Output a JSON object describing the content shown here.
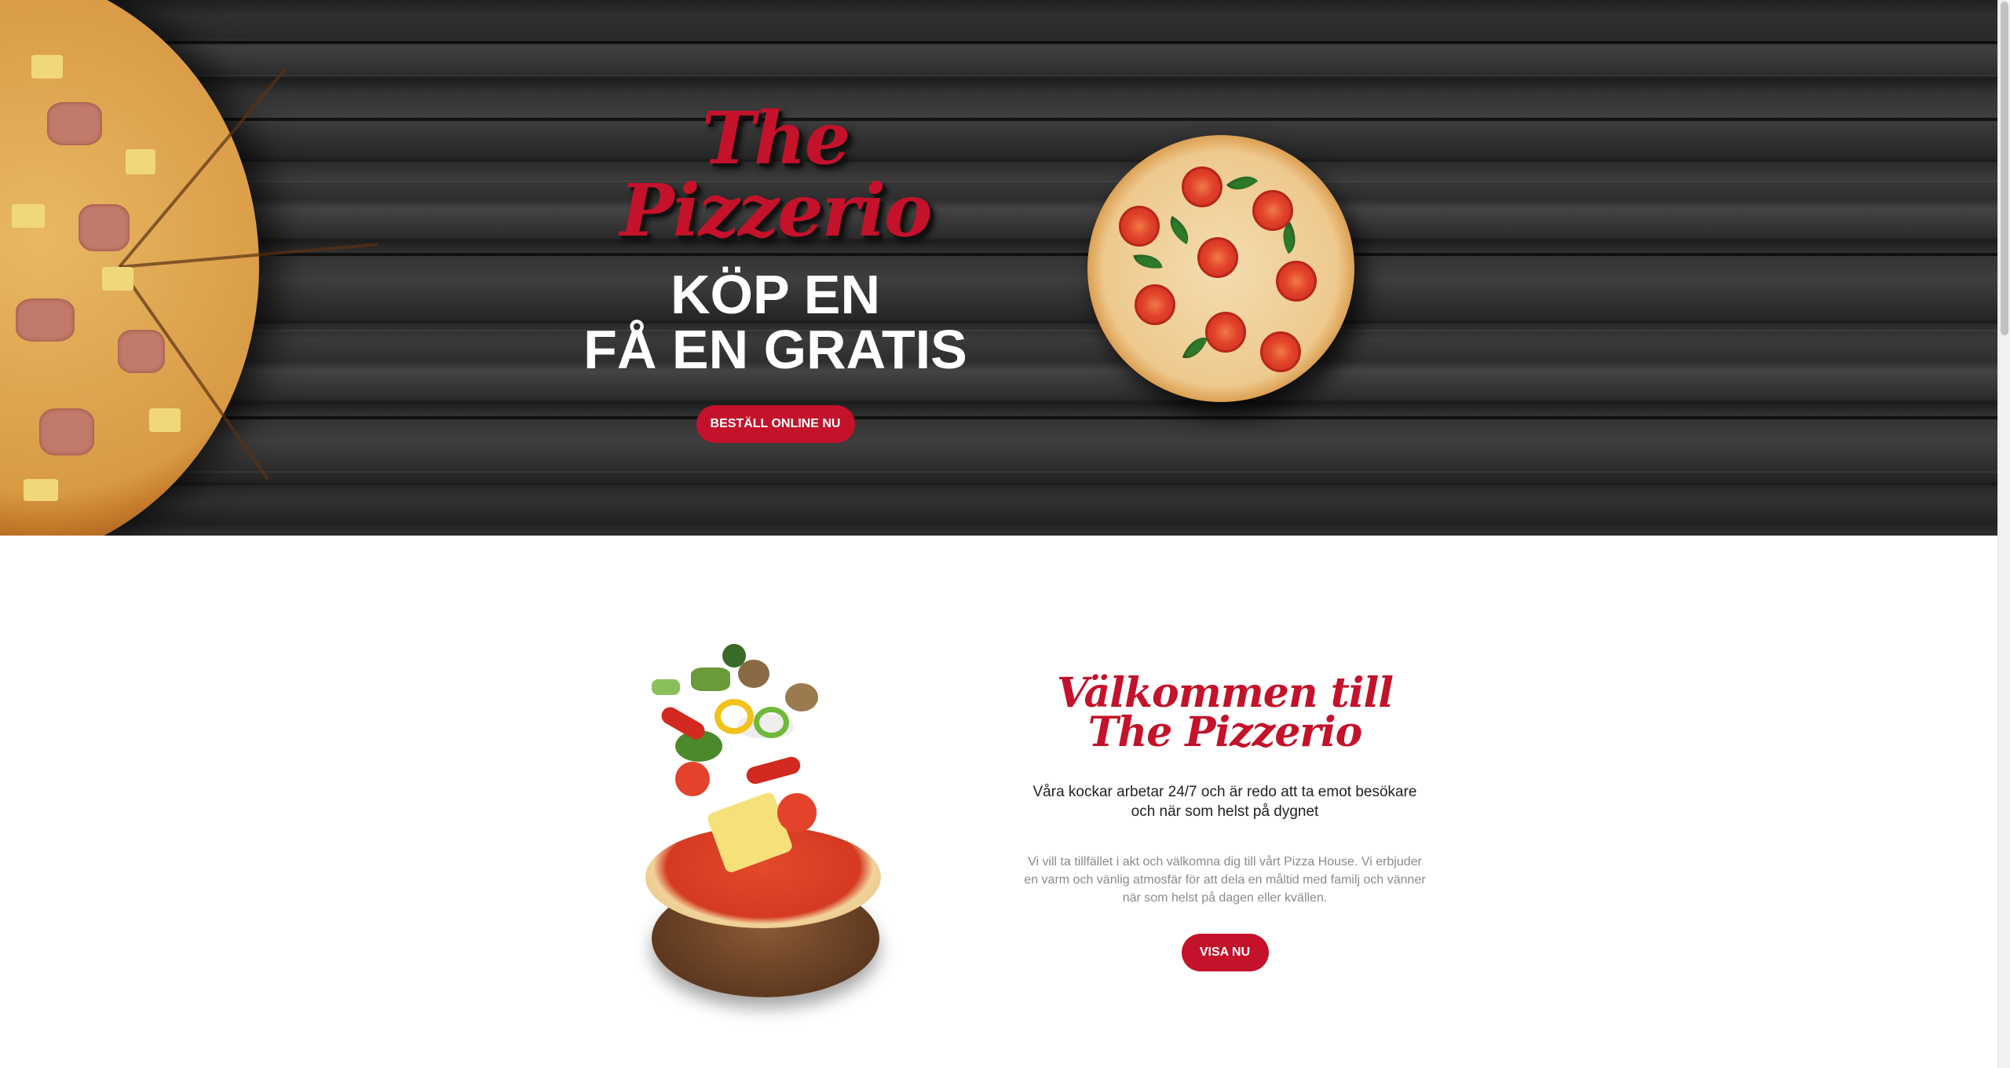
{
  "hero": {
    "brand": "The Pizzerio",
    "headline_line1": "KÖP EN",
    "headline_line2": "FÅ EN GRATIS",
    "cta_label": "BESTÄLL ONLINE NU"
  },
  "welcome": {
    "title": "Välkommen till The Pizzerio",
    "subtitle": "Våra kockar arbetar 24/7 och är redo att ta emot besökare och när som helst på dygnet",
    "body": "Vi vill ta tillfället i akt och välkomna dig till vårt Pizza House. Vi erbjuder en varm och vänlig atmosfär för att dela en måltid med familj och vänner när som helst på dagen eller kvällen.",
    "cta_label": "VISA NU"
  },
  "colors": {
    "accent": "#c4122b",
    "hero_bg": "#2d2d2d",
    "text_dark": "#222222",
    "text_muted": "#8a8a8a"
  },
  "images": {
    "hero_left": "half-pizza-image",
    "hero_right": "margherita-pizza-image",
    "welcome": "flying-ingredients-pizza-image"
  }
}
